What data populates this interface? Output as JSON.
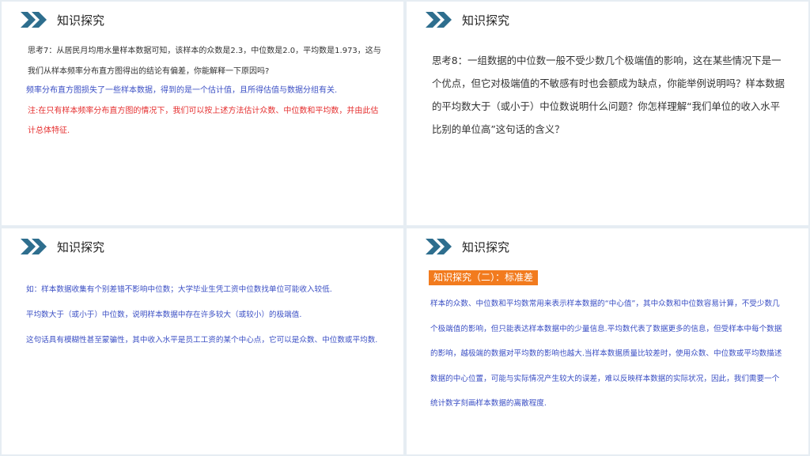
{
  "panels": [
    {
      "title": "知识探究",
      "paragraphs": [
        "思考7：从居民月均用水量样本数据可知，该样本的众数是2.3，中位数是2.0，平均数是1.973，这与我们从样本频率分布直方图得出的结论有偏差，你能解释一下原因吗?",
        "频率分布直方图损失了一些样本数据，得到的是一个估计值，且所得估值与数据分组有关.",
        "注:在只有样本频率分布直方图的情况下，我们可以按上述方法估计众数、中位数和平均数，并由此估计总体特征."
      ]
    },
    {
      "title": "知识探究",
      "paragraphs": [
        "思考8：一组数据的中位数一般不受少数几个极端值的影响，这在某些情况下是一个优点，但它对极端值的不敏感有时也会额成为缺点，你能举例说明吗？样本数据的平均数大于（或小于）中位数说明什么问题？你怎样理解“我们单位的收入水平比别的单位高”这句话的含义？"
      ]
    },
    {
      "title": "知识探究",
      "paragraphs": [
        "如：样本数据收集有个别差错不影响中位数；大学毕业生凭工资中位数找单位可能收入较低.",
        "平均数大于（或小于）中位数，说明样本数据中存在许多较大（或较小）的极端值.",
        "这句话具有模糊性甚至蒙骗性，其中收入水平是员工工资的某个中心点，它可以是众数、中位数或平均数."
      ]
    },
    {
      "title": "知识探究",
      "tag": "知识探究（二）：标准差",
      "paragraphs": [
        "样本的众数、中位数和平均数常用来表示样本数据的“中心值”，其中众数和中位数容易计算，不受少数几个极端值的影响，但只能表达样本数据中的少量信息.平均数代表了数据更多的信息，但受样本中每个数据的影响，越极端的数据对平均数的影响也越大.当样本数据质量比较差时，使用众数、中位数或平均数描述数据的中心位置，可能与实际情况产生较大的误差，难以反映样本数据的实际状况，因此，我们需要一个统计数字刻画样本数据的离散程度."
      ]
    }
  ],
  "colors": {
    "accent": "#2e6e8e",
    "tag_bg": "#f27b1e",
    "blue_text": "#3b4fc4",
    "red_text": "#e53030"
  },
  "icons": {
    "header": "double-chevron-icon"
  }
}
